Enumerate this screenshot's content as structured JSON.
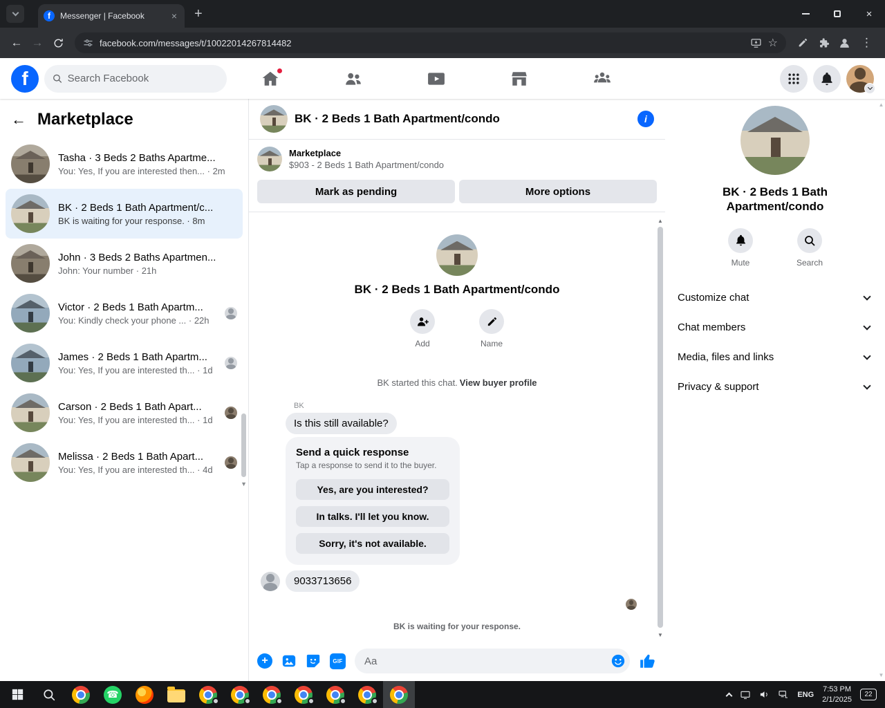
{
  "colors": {
    "fb_blue": "#0866ff",
    "messenger_blue": "#0084ff",
    "selected_chat_bg": "#e7f1fc",
    "notification_red": "#e41e3f"
  },
  "browser": {
    "tab_title": "Messenger | Facebook",
    "url": "facebook.com/messages/t/10022014267814482"
  },
  "header": {
    "search_placeholder": "Search Facebook"
  },
  "sidebar": {
    "title": "Marketplace",
    "chats": [
      {
        "name": "Tasha · 3 Beds 2 Baths Apartme...",
        "preview": "You: Yes, If you are interested then...",
        "time": "2m"
      },
      {
        "name": "BK · 2 Beds 1 Bath Apartment/c...",
        "preview": "BK is waiting for your response.",
        "time": "8m"
      },
      {
        "name": "John · 3 Beds 2 Baths Apartmen...",
        "preview": "John: Your number",
        "time": "21h"
      },
      {
        "name": "Victor · 2 Beds 1 Bath Apartm...",
        "preview": "You: Kindly check your phone ...",
        "time": "22h"
      },
      {
        "name": "James · 2 Beds 1 Bath Apartm...",
        "preview": "You: Yes, If you are interested th...",
        "time": "1d"
      },
      {
        "name": "Carson · 2 Beds 1 Bath Apart...",
        "preview": "You: Yes, If you are interested th...",
        "time": "1d"
      },
      {
        "name": "Melissa · 2 Beds 1 Bath Apart...",
        "preview": "You: Yes, If you are interested th...",
        "time": "4d"
      }
    ]
  },
  "chat": {
    "title": "BK · 2 Beds 1 Bath Apartment/condo",
    "marketplace": {
      "label": "Marketplace",
      "listing": "$903 - 2 Beds 1 Bath Apartment/condo",
      "mark_pending": "Mark as pending",
      "more_options": "More options"
    },
    "intro": {
      "title": "BK · 2 Beds 1 Bath Apartment/condo",
      "add": "Add",
      "name": "Name",
      "started": "BK started this chat.",
      "view_profile": "View buyer profile"
    },
    "sender": "BK",
    "incoming": "Is this still available?",
    "quick": {
      "title": "Send a quick response",
      "subtitle": "Tap a response to send it to the buyer.",
      "options": [
        "Yes, are you interested?",
        "In talks. I'll let you know.",
        "Sorry, it's not available."
      ]
    },
    "outgoing": "9033713656",
    "waiting": "BK is waiting for your response.",
    "composer": {
      "placeholder": "Aa",
      "gif": "GIF"
    }
  },
  "details": {
    "title": "BK · 2 Beds 1 Bath Apartment/condo",
    "mute": "Mute",
    "search": "Search",
    "sections": [
      "Customize chat",
      "Chat members",
      "Media, files and links",
      "Privacy & support"
    ]
  },
  "taskbar": {
    "lang": "ENG",
    "time": "7:53 PM",
    "date": "2/1/2025",
    "badge": "22"
  }
}
